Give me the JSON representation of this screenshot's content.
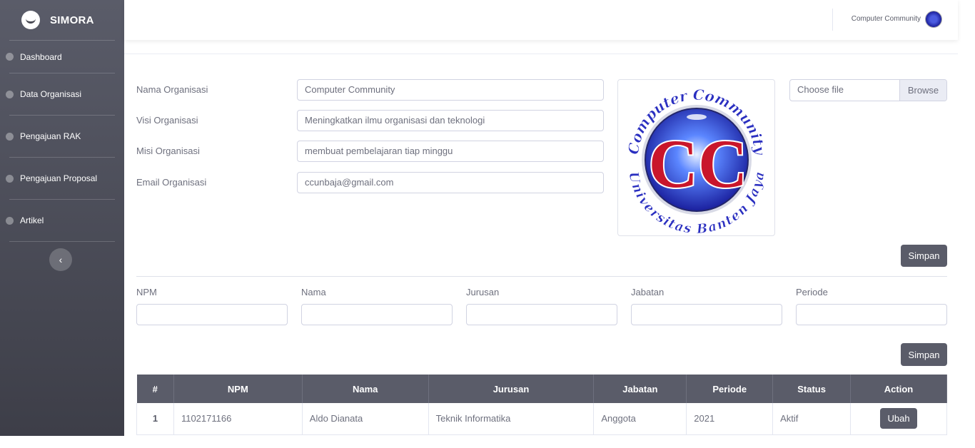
{
  "app": {
    "brand": "SIMORA"
  },
  "sidebar": {
    "items": [
      {
        "label": "Dashboard",
        "icon": "dashboard-icon"
      },
      {
        "label": "Data Organisasi",
        "icon": "dashboard-icon"
      },
      {
        "label": "Pengajuan RAK",
        "icon": "dashboard-icon"
      },
      {
        "label": "Pengajuan Proposal",
        "icon": "dashboard-icon"
      },
      {
        "label": "Artikel",
        "icon": "dashboard-icon"
      }
    ],
    "toggle_icon": "‹"
  },
  "topbar": {
    "user_name": "Computer Community"
  },
  "org_form": {
    "name_label": "Nama Organisasi",
    "name_value": "Computer Community",
    "visi_label": "Visi Organisasi",
    "visi_value": "Meningkatkan ilmu organisasi dan teknologi",
    "misi_label": "Misi Organisasi",
    "misi_value": "membuat pembelajaran tiap minggu",
    "email_label": "Email Organisasi",
    "email_value": "ccunbaja@gmail.com",
    "file_placeholder": "Choose file",
    "browse_label": "Browse",
    "save_label": "Simpan"
  },
  "logo": {
    "top_text": "Computer Community",
    "bottom_text": "Universitas Banten Jaya",
    "initials": "CC"
  },
  "member_form": {
    "npm_label": "NPM",
    "nama_label": "Nama",
    "jurusan_label": "Jurusan",
    "jabatan_label": "Jabatan",
    "periode_label": "Periode",
    "save_label": "Simpan"
  },
  "table": {
    "headers": [
      "#",
      "NPM",
      "Nama",
      "Jurusan",
      "Jabatan",
      "Periode",
      "Status",
      "Action"
    ],
    "rows": [
      {
        "no": "1",
        "npm": "1102171166",
        "nama": "Aldo Dianata",
        "jurusan": "Teknik Informatika",
        "jabatan": "Anggota",
        "periode": "2021",
        "status": "Aktif",
        "action": "Ubah"
      }
    ]
  }
}
